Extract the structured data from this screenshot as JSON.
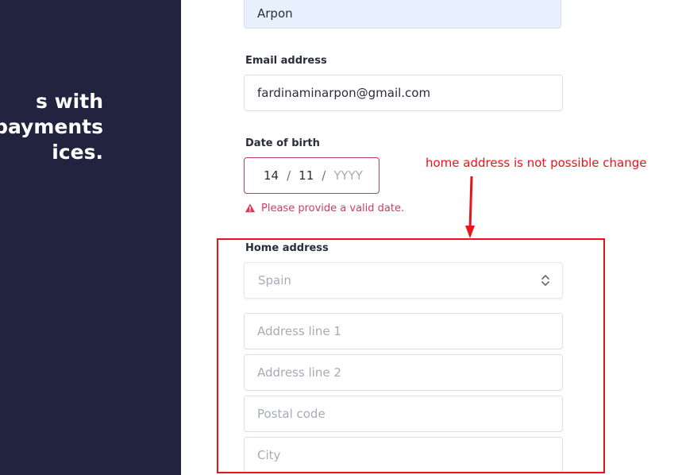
{
  "sidebar": {
    "headline_lines": [
      "s with",
      "payments",
      "ices."
    ]
  },
  "form": {
    "name_value": "Arpon",
    "email": {
      "label": "Email address",
      "value": "fardinaminarpon@gmail.com"
    },
    "dob": {
      "label": "Date of birth",
      "day": "14",
      "month": "11",
      "year_placeholder": "YYYY",
      "separator": "/",
      "error": "Please provide a valid date."
    },
    "home_address": {
      "label": "Home address",
      "country": "Spain",
      "address_line1_placeholder": "Address line 1",
      "address_line2_placeholder": "Address line 2",
      "postal_code_placeholder": "Postal code",
      "city_placeholder": "City"
    }
  },
  "annotation": {
    "note": "home address is not possible change",
    "color": "#e8141a"
  },
  "colors": {
    "sidebar_bg": "#21233f",
    "error": "#d53b5e",
    "autofill_bg": "#e8effd"
  },
  "icons": {
    "error": "warning-triangle-icon",
    "select": "chevron-up-down-icon"
  }
}
